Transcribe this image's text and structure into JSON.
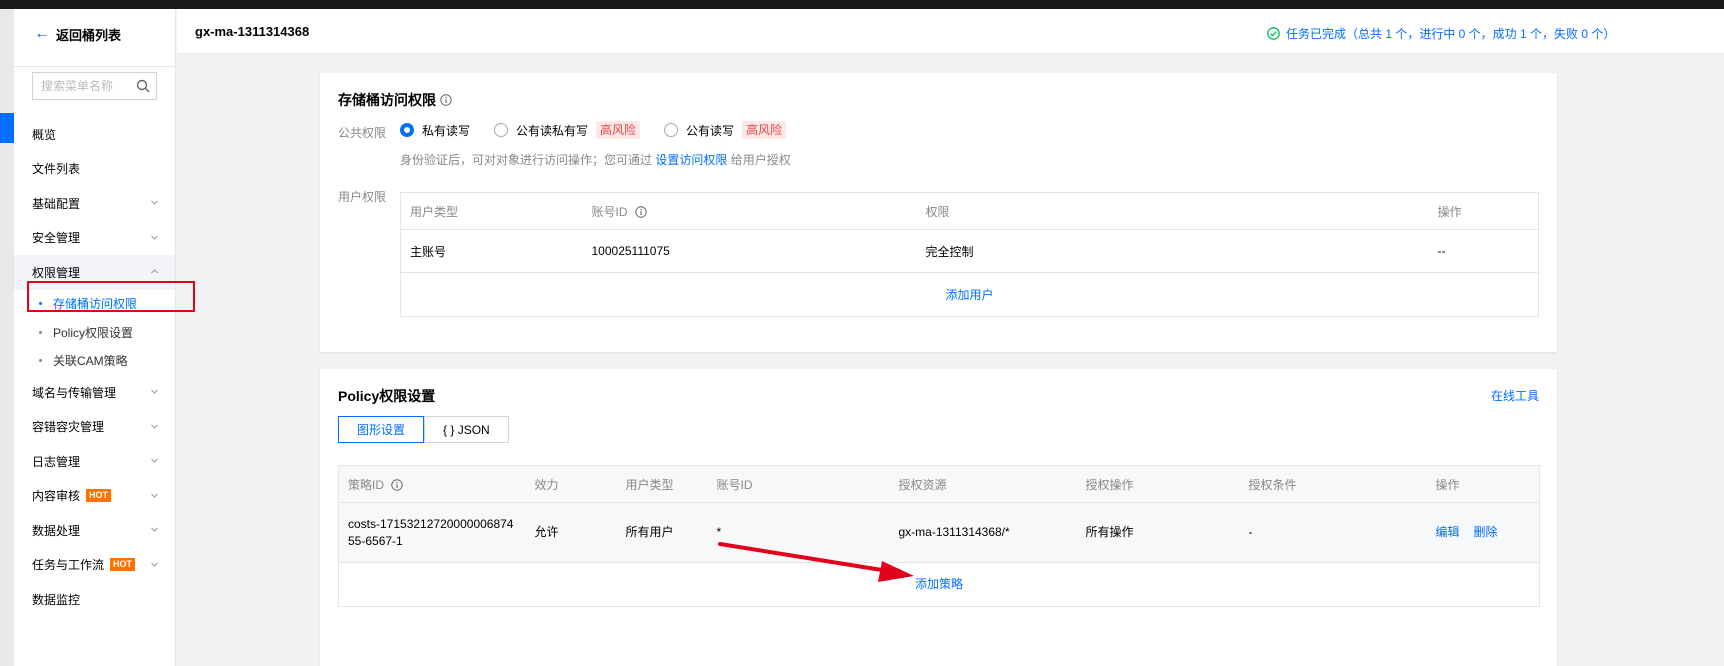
{
  "sidebar": {
    "back_label": "返回桶列表",
    "search_placeholder": "搜索菜单名称",
    "items": [
      {
        "label": "概览"
      },
      {
        "label": "文件列表"
      },
      {
        "label": "基础配置"
      },
      {
        "label": "安全管理"
      },
      {
        "label": "权限管理"
      },
      {
        "label": "域名与传输管理"
      },
      {
        "label": "容错容灾管理"
      },
      {
        "label": "日志管理"
      },
      {
        "label": "内容审核",
        "badge": "HOT"
      },
      {
        "label": "数据处理"
      },
      {
        "label": "任务与工作流",
        "badge": "HOT"
      },
      {
        "label": "数据监控"
      }
    ],
    "sub_items": [
      {
        "label": "存储桶访问权限"
      },
      {
        "label": "Policy权限设置"
      },
      {
        "label": "关联CAM策略"
      }
    ]
  },
  "header": {
    "bucket_name": "gx-ma-1311314368",
    "task_status": "任务已完成（总共 1 个，进行中 0 个，成功 1 个，失败 0 个）"
  },
  "access": {
    "title": "存储桶访问权限",
    "public_label": "公共权限",
    "options": [
      {
        "label": "私有读写",
        "selected": true
      },
      {
        "label": "公有读私有写",
        "risk": "高风险"
      },
      {
        "label": "公有读写",
        "risk": "高风险"
      }
    ],
    "hint_prefix": "身份验证后，可对对象进行访问操作；您可通过",
    "hint_link": "设置访问权限",
    "hint_suffix": "给用户授权",
    "user_label": "用户权限",
    "columns": [
      "用户类型",
      "账号ID",
      "权限",
      "操作"
    ],
    "rows": [
      {
        "type": "主账号",
        "account": "100025111075",
        "perm": "完全控制",
        "op": "--"
      }
    ],
    "add_user": "添加用户"
  },
  "policy": {
    "title": "Policy权限设置",
    "online_tool": "在线工具",
    "tabs": [
      "图形设置",
      "{ } JSON"
    ],
    "columns": [
      "策略ID",
      "效力",
      "用户类型",
      "账号ID",
      "授权资源",
      "授权操作",
      "授权条件",
      "操作"
    ],
    "rows": [
      {
        "id": "costs-1715321272000000687455-6567-1",
        "effect": "允许",
        "user_type": "所有用户",
        "account": "*",
        "resource": "gx-ma-1311314368/*",
        "action": "所有操作",
        "condition": "-",
        "edit": "编辑",
        "delete": "删除"
      }
    ],
    "add_policy": "添加策略"
  },
  "colors": {
    "accent": "#006eff",
    "success": "#0abf5b",
    "risk": "#e54545",
    "hot": "#ff7200",
    "highlight": "#e3001b"
  }
}
